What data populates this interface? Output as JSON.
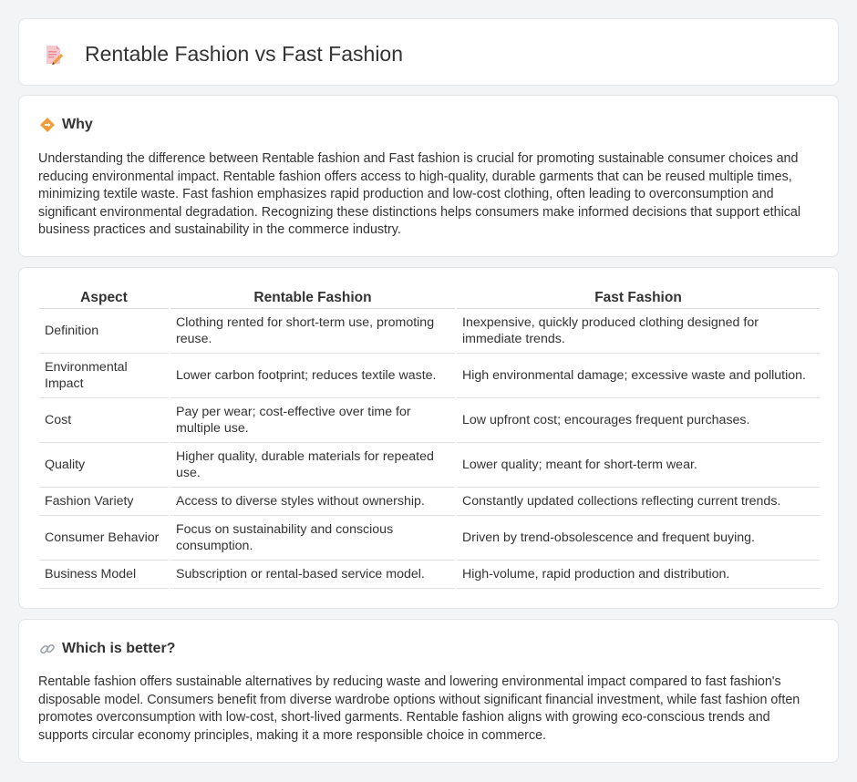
{
  "header": {
    "title": "Rentable Fashion vs Fast Fashion"
  },
  "why": {
    "heading": "Why",
    "text": "Understanding the difference between Rentable fashion and Fast fashion is crucial for promoting sustainable consumer choices and reducing environmental impact. Rentable fashion offers access to high-quality, durable garments that can be reused multiple times, minimizing textile waste. Fast fashion emphasizes rapid production and low-cost clothing, often leading to overconsumption and significant environmental degradation. Recognizing these distinctions helps consumers make informed decisions that support ethical business practices and sustainability in the commerce industry."
  },
  "table": {
    "headers": [
      "Aspect",
      "Rentable Fashion",
      "Fast Fashion"
    ],
    "rows": [
      [
        "Definition",
        "Clothing rented for short-term use, promoting reuse.",
        "Inexpensive, quickly produced clothing designed for immediate trends."
      ],
      [
        "Environmental Impact",
        "Lower carbon footprint; reduces textile waste.",
        "High environmental damage; excessive waste and pollution."
      ],
      [
        "Cost",
        "Pay per wear; cost-effective over time for multiple use.",
        "Low upfront cost; encourages frequent purchases."
      ],
      [
        "Quality",
        "Higher quality, durable materials for repeated use.",
        "Lower quality; meant for short-term wear."
      ],
      [
        "Fashion Variety",
        "Access to diverse styles without ownership.",
        "Constantly updated collections reflecting current trends."
      ],
      [
        "Consumer Behavior",
        "Focus on sustainability and conscious consumption.",
        "Driven by trend-obsolescence and frequent buying."
      ],
      [
        "Business Model",
        "Subscription or rental-based service model.",
        "High-volume, rapid production and distribution."
      ]
    ]
  },
  "better": {
    "heading": "Which is better?",
    "text": "Rentable fashion offers sustainable alternatives by reducing waste and lowering environmental impact compared to fast fashion's disposable model. Consumers benefit from diverse wardrobe options without significant financial investment, while fast fashion often promotes overconsumption with low-cost, short-lived garments. Rentable fashion aligns with growing eco-conscious trends and supports circular economy principles, making it a more responsible choice in commerce."
  },
  "icons": {
    "title": "document-pencil-icon",
    "why": "diamond-signpost-icon",
    "better": "link-icon"
  },
  "colors": {
    "accent": "#f39c3a",
    "icon_pink": "#f4a7b0"
  }
}
